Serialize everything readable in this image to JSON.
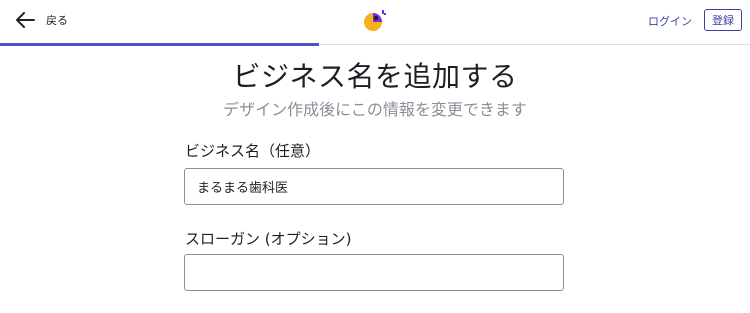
{
  "header": {
    "back_label": "戻る",
    "login_label": "ログイン",
    "register_label": "登録",
    "progress": 0.425
  },
  "main": {
    "title": "ビジネス名を追加する",
    "subtitle": "デザイン作成後にこの情報を変更できます",
    "business_name": {
      "label": "ビジネス名（任意）",
      "value": "まるまる歯科医"
    },
    "slogan": {
      "label": "スローガン (オプション)",
      "value": ""
    }
  },
  "colors": {
    "accent": "#4d53c4",
    "link": "#3b3fa8",
    "logo_yellow": "#f5b31b",
    "logo_purple": "#7a2bd6"
  },
  "icons": [
    "arrow-left-icon",
    "logo-icon"
  ]
}
